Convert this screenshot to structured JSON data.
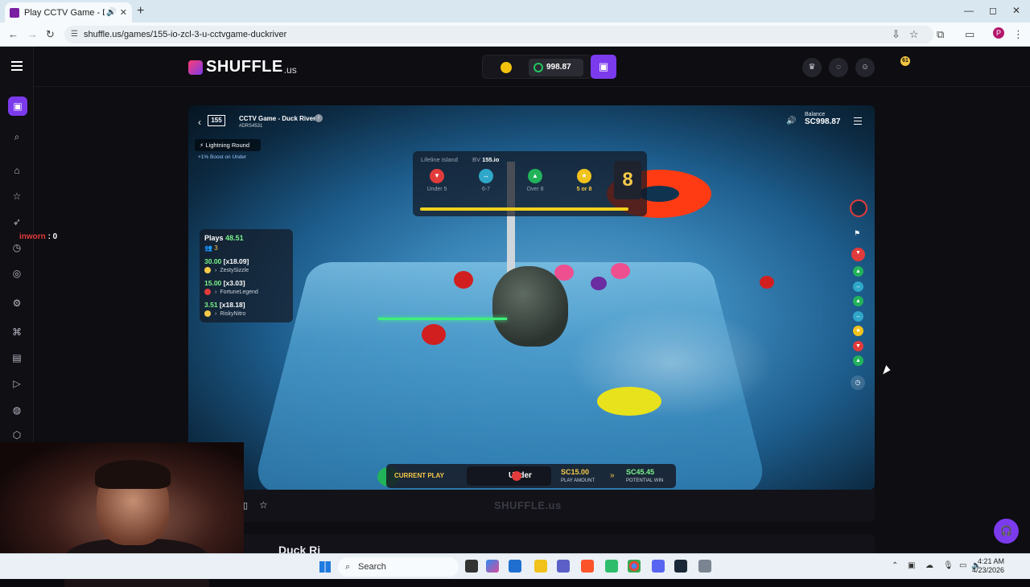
{
  "browser": {
    "tab_title": "Play CCTV Game - Duck Riv",
    "new_tab": "+",
    "url": "shuffle.us/games/155-io-zcl-3-u-cctvgame-duckriver",
    "profile_initial": "P",
    "window_controls": [
      "—",
      "◻",
      "✕"
    ]
  },
  "header": {
    "logo_text": "SHUFFLE",
    "logo_suffix": ".us",
    "balance": "998.87",
    "notif_count": "61"
  },
  "game": {
    "title": "CCTV Game - Duck River",
    "id": "#DRS4531",
    "brand": "155",
    "balance_label": "Balance",
    "balance_value": "SC998.87",
    "lightning_label": "Lightning Round",
    "boost_text": "+1% Boost on Under",
    "hud": {
      "location": "Lifeline Island",
      "bv_label": "BV",
      "bv_value": "155.io",
      "options": [
        {
          "label": "Under 5",
          "color": "#e23b3b",
          "glyph": "▼"
        },
        {
          "label": "6-7",
          "color": "#2fa7c9",
          "glyph": "↔"
        },
        {
          "label": "Over 8",
          "color": "#22b35a",
          "glyph": "▲"
        },
        {
          "label": "5 or 8",
          "color": "#f2c21c",
          "glyph": "★"
        }
      ],
      "current_number": "8",
      "progress_fraction": 0.96
    },
    "plays": {
      "label": "Plays",
      "total": "48.51",
      "count": "3",
      "rows": [
        {
          "amount": "30.00",
          "mult": "[x18.09]",
          "user": "ZestySizzle",
          "dot": "#f7c948"
        },
        {
          "amount": "15.00",
          "mult": "[x3.03]",
          "user": "FortuneLegend",
          "dot": "#e23b3b"
        },
        {
          "amount": "3.51",
          "mult": "[x18.18]",
          "user": "RiskyNitro",
          "dot": "#f7c948"
        }
      ]
    },
    "history_colors": [
      "#22b35a",
      "#2fa7c9",
      "#22b35a",
      "#2fa7c9",
      "#f2c21c",
      "#e23b3b",
      "#22b35a"
    ],
    "current_play": {
      "label": "CURRENT PLAY",
      "choice": "Under",
      "play_amount": "SC15.00",
      "play_amount_label": "PLAY AMOUNT",
      "potential_win": "SC45.45",
      "potential_win_label": "POTENTIAL WIN"
    },
    "footer_logo": "SHUFFLE.us"
  },
  "below_title": "Duck Ri",
  "chat": {
    "user": "inworn",
    "value": ": 0"
  },
  "taskbar": {
    "search_placeholder": "Search",
    "time": "4:21 AM",
    "date": "4/23/2026"
  }
}
